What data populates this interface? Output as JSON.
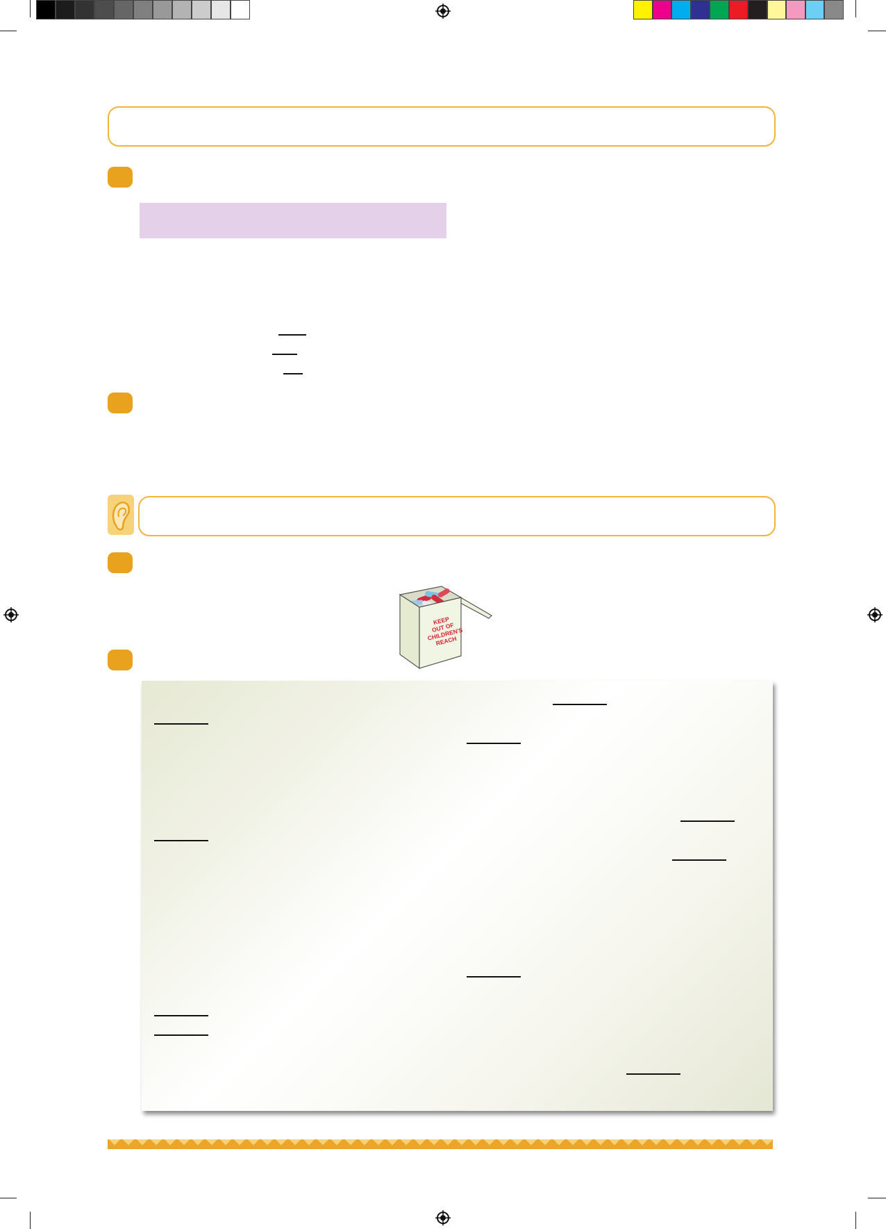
{
  "colors": {
    "grayscale": [
      "#000000",
      "#1c1c1c",
      "#333333",
      "#4d4d4d",
      "#666666",
      "#808080",
      "#999999",
      "#b3b3b3",
      "#cccccc",
      "#e6e6e6",
      "#ffffff"
    ],
    "process": [
      "#fff200",
      "#ec008c",
      "#00aeef",
      "#2e3192",
      "#00a651",
      "#ed1c24",
      "#231f20",
      "#fff799",
      "#f49ac1",
      "#6dcff6",
      "#898989"
    ],
    "accent": "#e9a21e",
    "banner_border": "#f2b43a",
    "highlight_box": "#e4d0e8"
  },
  "illustration": {
    "box_label": "KEEP OUT OF CHILDREN'S REACH",
    "box_label_lines": [
      "KEEP",
      "OUT OF",
      "CHILDREN'S",
      "REACH"
    ],
    "ear_icon": "ear-icon"
  }
}
